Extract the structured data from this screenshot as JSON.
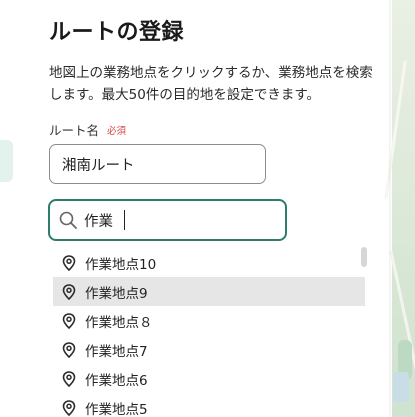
{
  "panel": {
    "title": "ルートの登録",
    "description": "地図上の業務地点をクリックするか、業務地点を検索します。最大50件の目的地を設定できます。"
  },
  "route_name_field": {
    "label": "ルート名",
    "required_label": "必須",
    "value": "湘南ルート"
  },
  "search": {
    "value": "作業",
    "icon": "search-icon"
  },
  "results": {
    "items": [
      {
        "label": "作業地点10",
        "active": false
      },
      {
        "label": "作業地点9",
        "active": true
      },
      {
        "label": "作業地点８",
        "active": false
      },
      {
        "label": "作業地点7",
        "active": false
      },
      {
        "label": "作業地点6",
        "active": false
      },
      {
        "label": "作業地点5",
        "active": false
      }
    ],
    "icon": "location-pin-icon"
  },
  "colors": {
    "accent": "#2e7d6b",
    "required": "#d64541",
    "active_row": "#e6e6e6"
  }
}
